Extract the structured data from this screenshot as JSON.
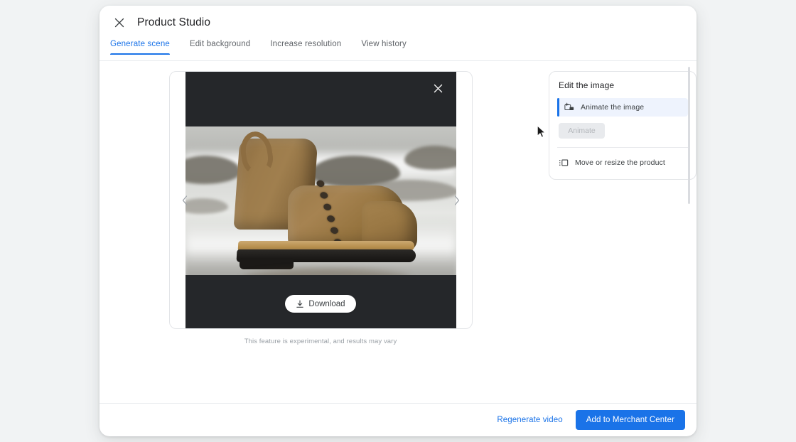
{
  "header": {
    "title": "Product Studio",
    "close_icon": "close-icon"
  },
  "tabs": [
    {
      "label": "Generate scene",
      "active": true
    },
    {
      "label": "Edit background",
      "active": false
    },
    {
      "label": "Increase resolution",
      "active": false
    },
    {
      "label": "View history",
      "active": false
    }
  ],
  "viewer": {
    "collapse_icon": "close-icon",
    "prev_icon": "chevron-left-icon",
    "next_icon": "chevron-right-icon",
    "download_label": "Download",
    "download_icon": "download-icon",
    "disclaimer": "This feature is experimental, and results may vary",
    "scene_description": "Brown suede leather boot on wet rocks by the ocean"
  },
  "panel": {
    "title": "Edit the image",
    "options": [
      {
        "label": "Animate the image",
        "icon": "animate-image-icon",
        "selected": true
      },
      {
        "label": "Move or resize the product",
        "icon": "move-resize-icon",
        "selected": false
      }
    ],
    "animate_button": {
      "label": "Animate",
      "disabled": true
    }
  },
  "footer": {
    "regenerate_label": "Regenerate video",
    "add_label": "Add to Merchant Center"
  },
  "colors": {
    "accent": "#1a73e8",
    "text_primary": "#202124",
    "text_secondary": "#5f6368",
    "surface": "#ffffff",
    "backdrop": "#f1f3f4",
    "selected_row": "#eef3fd",
    "disabled": "#e8eaed"
  }
}
